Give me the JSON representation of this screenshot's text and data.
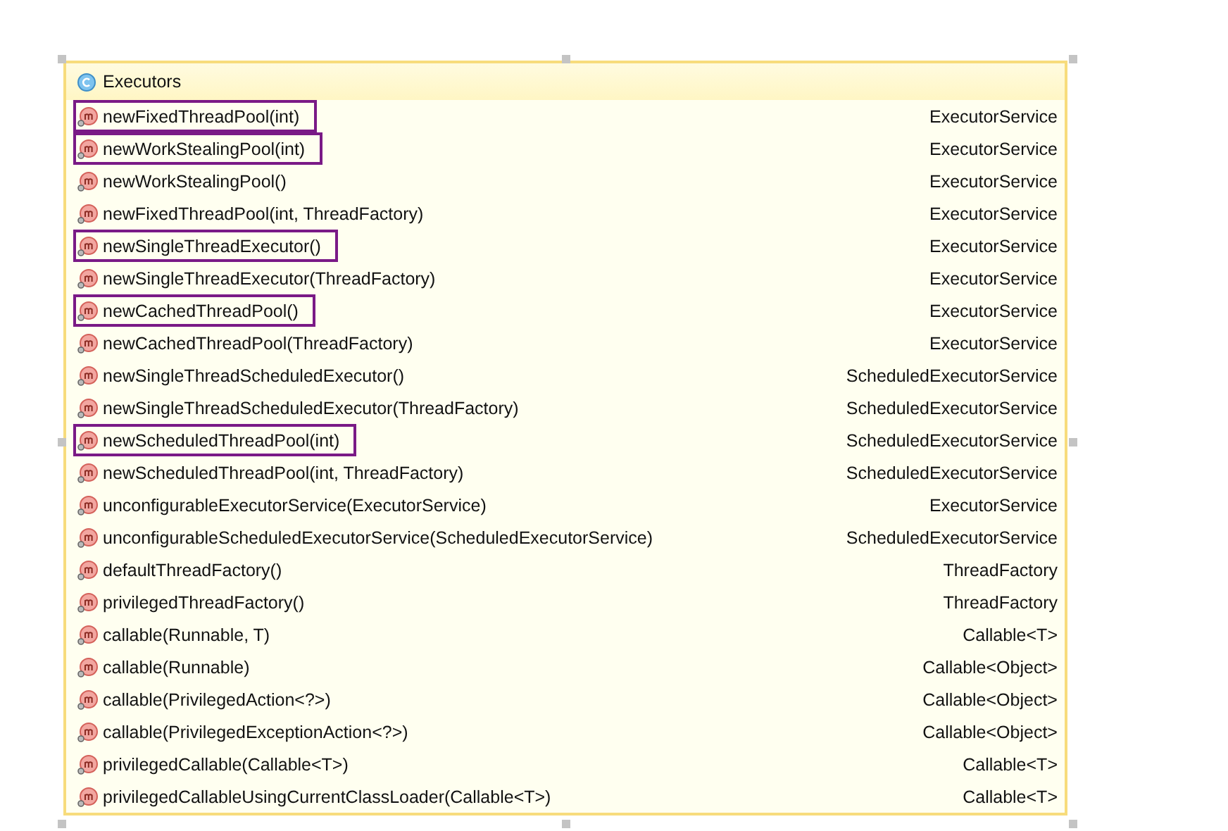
{
  "header": {
    "title": "Executors"
  },
  "rows": [
    {
      "name": "newFixedThreadPool(int)",
      "type": "ExecutorService",
      "highlighted": true
    },
    {
      "name": "newWorkStealingPool(int)",
      "type": "ExecutorService",
      "highlighted": true
    },
    {
      "name": "newWorkStealingPool()",
      "type": "ExecutorService",
      "highlighted": false
    },
    {
      "name": "newFixedThreadPool(int, ThreadFactory)",
      "type": "ExecutorService",
      "highlighted": false
    },
    {
      "name": "newSingleThreadExecutor()",
      "type": "ExecutorService",
      "highlighted": true
    },
    {
      "name": "newSingleThreadExecutor(ThreadFactory)",
      "type": "ExecutorService",
      "highlighted": false
    },
    {
      "name": "newCachedThreadPool()",
      "type": "ExecutorService",
      "highlighted": true
    },
    {
      "name": "newCachedThreadPool(ThreadFactory)",
      "type": "ExecutorService",
      "highlighted": false
    },
    {
      "name": "newSingleThreadScheduledExecutor()",
      "type": "ScheduledExecutorService",
      "highlighted": false
    },
    {
      "name": "newSingleThreadScheduledExecutor(ThreadFactory)",
      "type": "ScheduledExecutorService",
      "highlighted": false
    },
    {
      "name": "newScheduledThreadPool(int)",
      "type": "ScheduledExecutorService",
      "highlighted": true
    },
    {
      "name": "newScheduledThreadPool(int, ThreadFactory)",
      "type": "ScheduledExecutorService",
      "highlighted": false
    },
    {
      "name": "unconfigurableExecutorService(ExecutorService)",
      "type": "ExecutorService",
      "highlighted": false
    },
    {
      "name": "unconfigurableScheduledExecutorService(ScheduledExecutorService)",
      "type": "ScheduledExecutorService",
      "highlighted": false
    },
    {
      "name": "defaultThreadFactory()",
      "type": "ThreadFactory",
      "highlighted": false
    },
    {
      "name": "privilegedThreadFactory()",
      "type": "ThreadFactory",
      "highlighted": false
    },
    {
      "name": "callable(Runnable, T)",
      "type": "Callable<T>",
      "highlighted": false
    },
    {
      "name": "callable(Runnable)",
      "type": "Callable<Object>",
      "highlighted": false
    },
    {
      "name": "callable(PrivilegedAction<?>)",
      "type": "Callable<Object>",
      "highlighted": false
    },
    {
      "name": "callable(PrivilegedExceptionAction<?>)",
      "type": "Callable<Object>",
      "highlighted": false
    },
    {
      "name": "privilegedCallable(Callable<T>)",
      "type": "Callable<T>",
      "highlighted": false
    },
    {
      "name": "privilegedCallableUsingCurrentClassLoader(Callable<T>)",
      "type": "Callable<T>",
      "highlighted": false
    }
  ]
}
